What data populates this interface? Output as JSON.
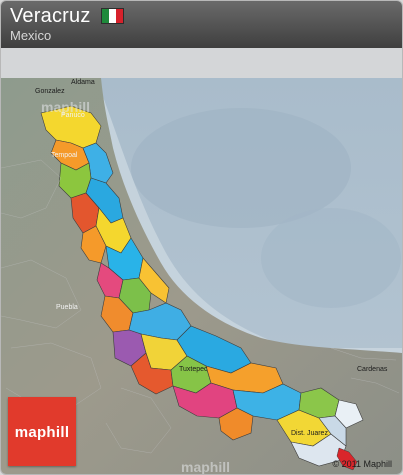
{
  "header": {
    "title": "Veracruz",
    "subtitle": "Mexico",
    "flag_colors": [
      "#1f8a3b",
      "#ffffff",
      "#d7212b"
    ]
  },
  "map": {
    "places": [
      {
        "name": "Aldama",
        "style": "dark"
      },
      {
        "name": "Gonzalez",
        "style": "dark"
      },
      {
        "name": "Panuco",
        "style": "light"
      },
      {
        "name": "Tempoal",
        "style": "light"
      },
      {
        "name": "Puebla",
        "style": "light"
      },
      {
        "name": "Tuxtepec",
        "style": "dark"
      },
      {
        "name": "Cardenas",
        "style": "dark"
      },
      {
        "name": "Dist. Juarez",
        "style": "dark"
      }
    ],
    "watermark": "maphill"
  },
  "logo": {
    "label": "maphill"
  },
  "footer": {
    "copyright": "© 2011 Maphill"
  }
}
